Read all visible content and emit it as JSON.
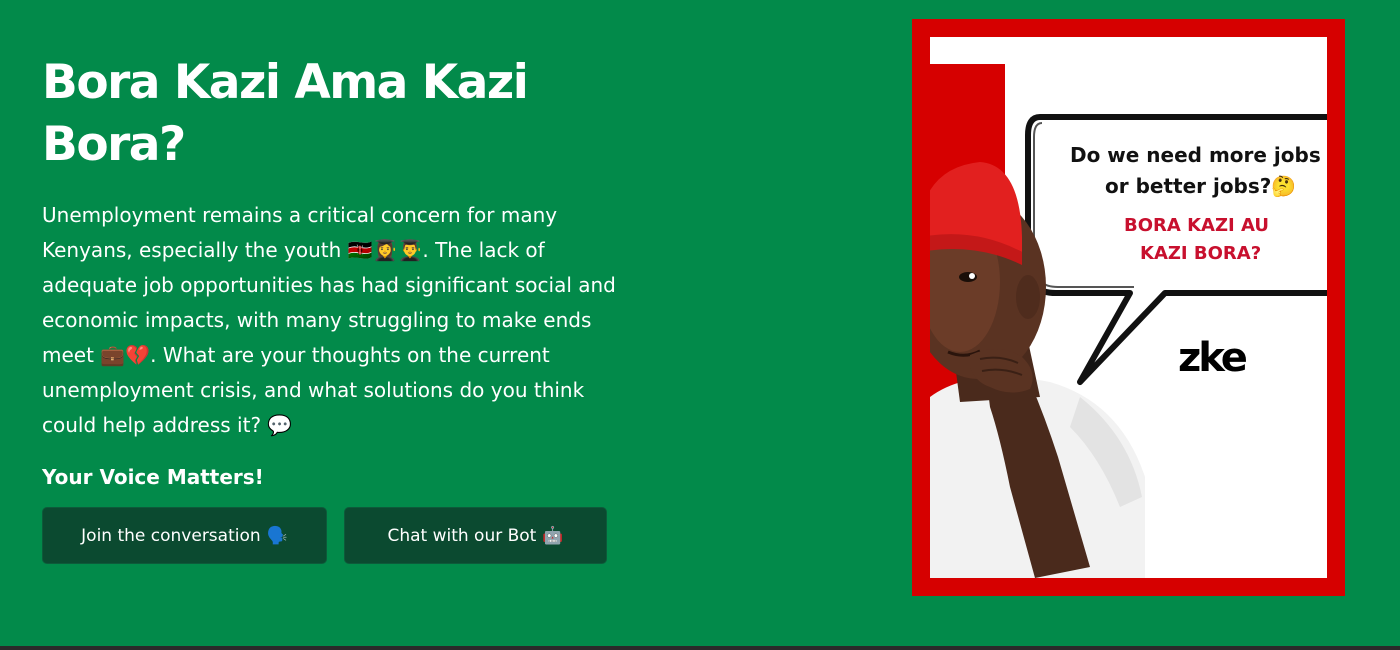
{
  "hero": {
    "title": "Bora Kazi Ama Kazi Bora?",
    "description_parts": {
      "p1": "Unemployment remains a critical concern for many Kenyans, especially the youth ",
      "emoji1": "🇰🇪👩‍🎓👨‍🎓",
      "p2": ". The lack of adequate job opportunities has had significant social and economic impacts, with many struggling to make ends meet ",
      "emoji2": "💼💔",
      "p3": ". What are your thoughts on the current unemployment crisis, and what solutions do you think could help address it? ",
      "emoji3": "💬"
    },
    "subheading": "Your Voice Matters!",
    "buttons": {
      "join_label": "Join the conversation",
      "join_emoji": "🗣️",
      "bot_label": "Chat with our Bot",
      "bot_emoji": "🤖"
    }
  },
  "poster": {
    "question_line1": "Do we need more jobs",
    "question_line2": "or better jobs?🤔",
    "swahili_line1": "BORA KAZI AU",
    "swahili_line2": "KAZI BORA?",
    "logo_text": "zke"
  },
  "colors": {
    "background": "#028a4a",
    "button": "#0b4a30",
    "poster_red": "#d60000",
    "swahili_red": "#c8102e"
  }
}
